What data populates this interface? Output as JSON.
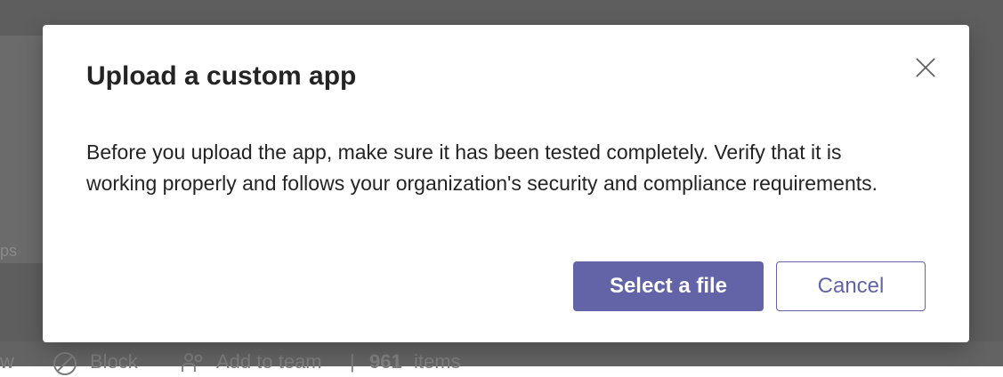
{
  "background": {
    "panel_fragment": "ps",
    "toolbar": {
      "fragment": "w",
      "block_label": "Block",
      "add_to_team_label": "Add to team",
      "separator": "|",
      "item_count": "961",
      "items_label": "items"
    }
  },
  "dialog": {
    "title": "Upload a custom app",
    "body": "Before you upload the app, make sure it has been tested completely. Verify that it is working properly and follows your organization's security and compliance requirements.",
    "primary_button": "Select a file",
    "secondary_button": "Cancel",
    "close_icon": "close-icon"
  },
  "colors": {
    "accent": "#6264a7",
    "overlay": "#5e5e5e",
    "text": "#242424"
  }
}
